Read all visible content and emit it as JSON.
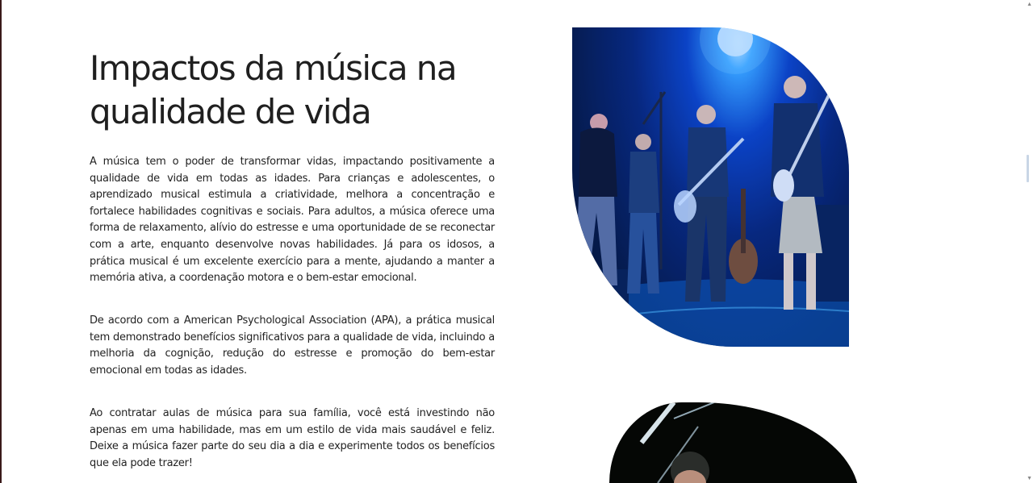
{
  "section": {
    "title": "Impactos da música na qualidade de vida",
    "paragraphs": [
      "A música tem o poder de transformar vidas, impactando positivamente a qualidade de vida em todas as idades. Para crianças e adolescentes, o aprendizado musical estimula a criatividade, melhora a concentração e fortalece habilidades cognitivas e sociais. Para adultos, a música oferece uma forma de relaxamento, alívio do estresse e uma oportunidade de se reconectar com a arte, enquanto desenvolve novas habilidades. Já para os idosos, a prática musical é um excelente exercício para a mente, ajudando a manter a memória ativa, a coordenação motora e o bem-estar emocional.",
      "De acordo com a American Psychological Association (APA), a prática musical tem demonstrado benefícios significativos para a qualidade de vida, incluindo a melhoria da cognição, redução do estresse e promoção do bem-estar emocional em todas as idades.",
      "Ao contratar aulas de música para sua família, você está investindo não apenas em uma habilidade, mas em um estilo de vida mais saudável e feliz. Deixe a música fazer parte do seu dia a dia e experimente todos os benefícios que ela pode trazer!"
    ]
  },
  "colors": {
    "stage_light": "#3aa8ff",
    "stage_dark": "#031133",
    "text": "#222222"
  },
  "scrollbar": {
    "up_icon": "scroll-up-arrow-icon",
    "down_icon": "scroll-down-arrow-icon"
  }
}
